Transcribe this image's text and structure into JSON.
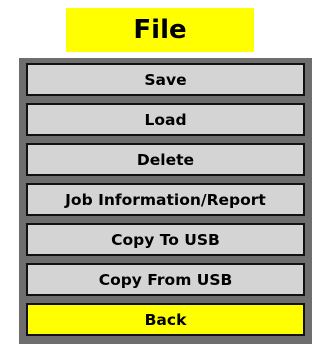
{
  "header": {
    "title": "File"
  },
  "menu": {
    "items": [
      {
        "label": "Save"
      },
      {
        "label": "Load"
      },
      {
        "label": "Delete"
      },
      {
        "label": "Job Information/Report"
      },
      {
        "label": "Copy To USB"
      },
      {
        "label": "Copy From USB"
      }
    ],
    "back_label": "Back"
  },
  "colors": {
    "title_background": "#ffff00",
    "panel_background": "#6e6e6e",
    "button_background": "#d4d4d4",
    "back_button_background": "#ffff00"
  }
}
